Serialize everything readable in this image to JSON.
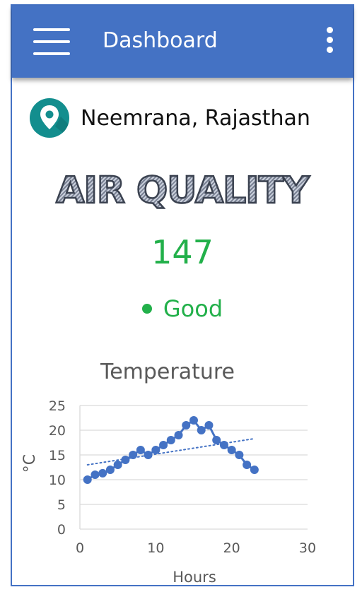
{
  "header": {
    "title": "Dashboard",
    "menu_icon": "hamburger-menu-icon",
    "more_icon": "more-vertical-icon",
    "background": "#4472c4"
  },
  "location": {
    "icon": "map-pin-icon",
    "name": "Neemrana, Rajasthan"
  },
  "air_quality": {
    "title": "AIR QUALITY",
    "value": "147",
    "status": "Good",
    "status_color": "#22b04a"
  },
  "chart_data": {
    "type": "scatter",
    "title": "Temperature",
    "xlabel": "Hours",
    "ylabel": "°C",
    "xlim": [
      0,
      30
    ],
    "ylim": [
      0,
      25
    ],
    "x_ticks": [
      0,
      10,
      20,
      30
    ],
    "y_ticks": [
      0,
      5,
      10,
      15,
      20,
      25
    ],
    "grid": true,
    "series": [
      {
        "x": [
          1,
          2,
          3,
          4,
          5,
          6,
          7,
          8,
          9,
          10,
          11,
          12,
          13,
          14,
          15,
          16,
          17,
          18,
          19,
          20,
          21,
          22,
          23
        ],
        "y": [
          10,
          11,
          11.3,
          12,
          13,
          14,
          15,
          16,
          15,
          16,
          17,
          18,
          19,
          21,
          22,
          20,
          21,
          18,
          17,
          16,
          15,
          13,
          12
        ],
        "color": "#4472c4",
        "connected": true
      }
    ],
    "trendline": {
      "type": "linear",
      "x": [
        1,
        23
      ],
      "y": [
        13,
        18.3
      ],
      "style": "dotted"
    }
  }
}
